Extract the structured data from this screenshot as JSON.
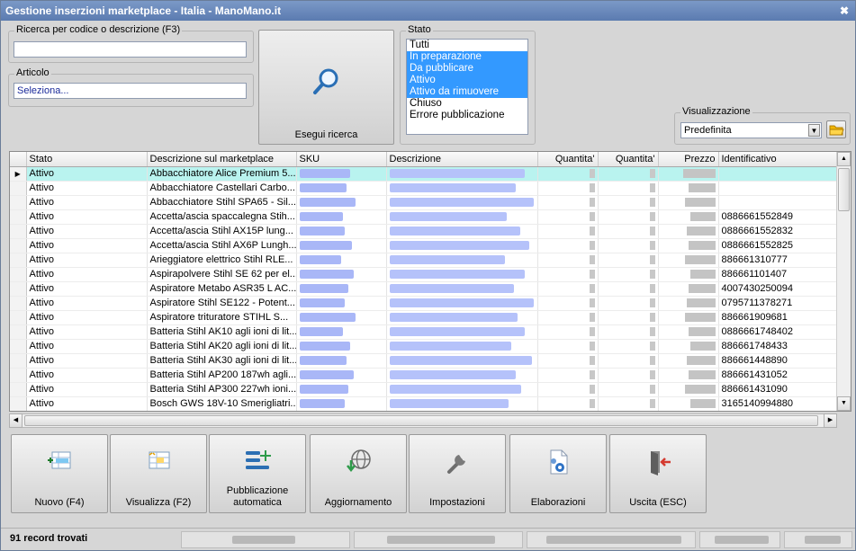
{
  "window": {
    "title": "Gestione inserzioni marketplace - Italia - ManoMano.it",
    "close_label": "✖"
  },
  "search": {
    "label": "Ricerca per codice o descrizione (F3)",
    "value": "",
    "article_label": "Articolo",
    "article_value": "Seleziona...",
    "button_label": "Esegui ricerca"
  },
  "status_filter": {
    "label": "Stato",
    "options": [
      {
        "label": "Tutti",
        "selected": false
      },
      {
        "label": "In preparazione",
        "selected": true
      },
      {
        "label": "Da pubblicare",
        "selected": true
      },
      {
        "label": "Attivo",
        "selected": true
      },
      {
        "label": "Attivo da rimuovere",
        "selected": true
      },
      {
        "label": "Chiuso",
        "selected": false
      },
      {
        "label": "Errore pubblicazione",
        "selected": false
      }
    ]
  },
  "view": {
    "label": "Visualizzazione",
    "value": "Predefinita"
  },
  "grid": {
    "columns": [
      "Stato",
      "Descrizione sul marketplace",
      "SKU",
      "Descrizione",
      "Quantita'",
      "Quantita'",
      "Prezzo",
      "Identificativo"
    ],
    "rows": [
      {
        "stato": "Attivo",
        "desc": "Abbacchiatore Alice Premium 5...",
        "id": "",
        "current": true
      },
      {
        "stato": "Attivo",
        "desc": "Abbacchiatore Castellari Carbo...",
        "id": ""
      },
      {
        "stato": "Attivo",
        "desc": "Abbacchiatore Stihl SPA65 - Sil...",
        "id": ""
      },
      {
        "stato": "Attivo",
        "desc": "Accetta/ascia spaccalegna Stih...",
        "id": "0886661552849"
      },
      {
        "stato": "Attivo",
        "desc": "Accetta/ascia Stihl AX15P lung...",
        "id": "0886661552832"
      },
      {
        "stato": "Attivo",
        "desc": "Accetta/ascia Stihl AX6P Lungh...",
        "id": "0886661552825"
      },
      {
        "stato": "Attivo",
        "desc": "Arieggiatore elettrico Stihl RLE...",
        "id": "886661310777"
      },
      {
        "stato": "Attivo",
        "desc": "Aspirapolvere Stihl SE 62 per el...",
        "id": "886661101407"
      },
      {
        "stato": "Attivo",
        "desc": "Aspiratore Metabo ASR35 L AC...",
        "id": "4007430250094"
      },
      {
        "stato": "Attivo",
        "desc": "Aspiratore Stihl SE122 - Potent...",
        "id": "0795711378271"
      },
      {
        "stato": "Attivo",
        "desc": "Aspiratore trituratore STIHL S...",
        "id": "886661909681"
      },
      {
        "stato": "Attivo",
        "desc": "Batteria Stihl AK10 agli ioni di lit...",
        "id": "0886661748402"
      },
      {
        "stato": "Attivo",
        "desc": "Batteria Stihl AK20 agli ioni di lit...",
        "id": "886661748433"
      },
      {
        "stato": "Attivo",
        "desc": "Batteria Stihl AK30 agli ioni di lit...",
        "id": "886661448890"
      },
      {
        "stato": "Attivo",
        "desc": "Batteria Stihl AP200 187wh agli...",
        "id": "886661431052"
      },
      {
        "stato": "Attivo",
        "desc": "Batteria Stihl AP300 227wh ioni...",
        "id": "886661431090"
      },
      {
        "stato": "Attivo",
        "desc": "Bosch GWS 18V-10 Smerigliatri...",
        "id": "3165140994880"
      }
    ]
  },
  "actions": [
    {
      "label": "Nuovo (F4)",
      "icon": "new-record-icon"
    },
    {
      "label": "Visualizza (F2)",
      "icon": "view-record-icon"
    },
    {
      "label": "Pubblicazione automatica",
      "icon": "auto-publish-icon"
    },
    {
      "label": "Aggiornamento",
      "icon": "update-globe-icon"
    },
    {
      "label": "Impostazioni",
      "icon": "wrench-icon"
    },
    {
      "label": "Elaborazioni",
      "icon": "processing-document-icon"
    },
    {
      "label": "Uscita (ESC)",
      "icon": "exit-door-icon"
    }
  ],
  "statusbar": {
    "records": "91 record trovati"
  },
  "colors": {
    "selection": "#3399ff",
    "current_row": "#b9f3ef",
    "titlebar": "#5b7bb0"
  }
}
